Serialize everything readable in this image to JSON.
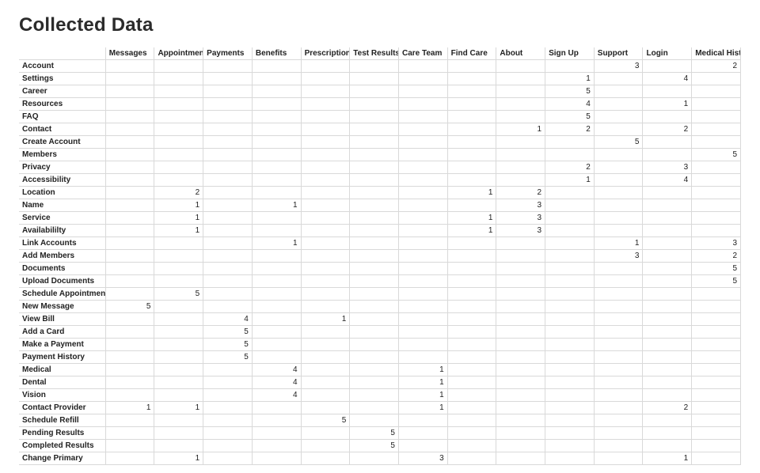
{
  "title": "Collected Data",
  "chart_data": {
    "type": "table",
    "title": "Collected Data",
    "columns": [
      "Messages",
      "Appointments",
      "Payments",
      "Benefits",
      "Prescriptions",
      "Test Results",
      "Care Team",
      "Find Care",
      "About",
      "Sign Up",
      "Support",
      "Login",
      "Medical History"
    ],
    "rows": [
      "Account",
      "Settings",
      "Career",
      "Resources",
      "FAQ",
      "Contact",
      "Create Account",
      "Members",
      "Privacy",
      "Accessibility",
      "Location",
      "Name",
      "Service",
      "Availabililty",
      "Link Accounts",
      "Add Members",
      "Documents",
      "Upload Documents",
      "Schedule Appointment",
      "New Message",
      "View Bill",
      "Add a Card",
      "Make a Payment",
      "Payment History",
      "Medical",
      "Dental",
      "Vision",
      "Contact Provider",
      "Schedule Refill",
      "Pending Results",
      "Completed Results",
      "Change Primary"
    ],
    "values": [
      [
        null,
        null,
        null,
        null,
        null,
        null,
        null,
        null,
        null,
        null,
        3,
        null,
        null,
        2
      ],
      [
        null,
        null,
        null,
        null,
        null,
        null,
        null,
        null,
        null,
        1,
        null,
        4,
        null,
        null
      ],
      [
        null,
        null,
        null,
        null,
        null,
        null,
        null,
        null,
        null,
        5,
        null,
        null,
        null,
        null
      ],
      [
        null,
        null,
        null,
        null,
        null,
        null,
        null,
        null,
        null,
        4,
        null,
        1,
        null,
        null
      ],
      [
        null,
        null,
        null,
        null,
        null,
        null,
        null,
        null,
        null,
        5,
        null,
        null,
        null,
        null
      ],
      [
        null,
        null,
        null,
        null,
        null,
        null,
        null,
        null,
        1,
        2,
        null,
        2,
        null,
        null
      ],
      [
        null,
        null,
        null,
        null,
        null,
        null,
        null,
        null,
        null,
        null,
        5,
        null,
        null,
        null
      ],
      [
        null,
        null,
        null,
        null,
        null,
        null,
        null,
        null,
        null,
        null,
        null,
        null,
        5,
        null
      ],
      [
        null,
        null,
        null,
        null,
        null,
        null,
        null,
        null,
        null,
        2,
        null,
        3,
        null,
        null
      ],
      [
        null,
        null,
        null,
        null,
        null,
        null,
        null,
        null,
        null,
        1,
        null,
        4,
        null,
        null
      ],
      [
        null,
        2,
        null,
        null,
        null,
        null,
        null,
        1,
        2,
        null,
        null,
        null,
        null,
        null
      ],
      [
        null,
        1,
        null,
        1,
        null,
        null,
        null,
        null,
        3,
        null,
        null,
        null,
        null,
        null
      ],
      [
        null,
        1,
        null,
        null,
        null,
        null,
        null,
        1,
        3,
        null,
        null,
        null,
        null,
        null
      ],
      [
        null,
        1,
        null,
        null,
        null,
        null,
        null,
        1,
        3,
        null,
        null,
        null,
        null,
        null
      ],
      [
        null,
        null,
        null,
        1,
        null,
        null,
        null,
        null,
        null,
        null,
        1,
        null,
        3,
        null
      ],
      [
        null,
        null,
        null,
        null,
        null,
        null,
        null,
        null,
        null,
        null,
        3,
        null,
        2,
        null
      ],
      [
        null,
        null,
        null,
        null,
        null,
        null,
        null,
        null,
        null,
        null,
        null,
        null,
        null,
        5
      ],
      [
        null,
        null,
        null,
        null,
        null,
        null,
        null,
        null,
        null,
        null,
        null,
        null,
        null,
        5
      ],
      [
        null,
        5,
        null,
        null,
        null,
        null,
        null,
        null,
        null,
        null,
        null,
        null,
        null,
        null
      ],
      [
        5,
        null,
        null,
        null,
        null,
        null,
        null,
        null,
        null,
        null,
        null,
        null,
        null,
        null
      ],
      [
        null,
        null,
        4,
        null,
        1,
        null,
        null,
        null,
        null,
        null,
        null,
        null,
        null,
        null
      ],
      [
        null,
        null,
        5,
        null,
        null,
        null,
        null,
        null,
        null,
        null,
        null,
        null,
        null,
        null
      ],
      [
        null,
        null,
        5,
        null,
        null,
        null,
        null,
        null,
        null,
        null,
        null,
        null,
        null,
        null
      ],
      [
        null,
        null,
        5,
        null,
        null,
        null,
        null,
        null,
        null,
        null,
        null,
        null,
        null,
        null
      ],
      [
        null,
        null,
        null,
        4,
        null,
        null,
        1,
        null,
        null,
        null,
        null,
        null,
        null,
        null
      ],
      [
        null,
        null,
        null,
        4,
        null,
        null,
        1,
        null,
        null,
        null,
        null,
        null,
        null,
        null
      ],
      [
        null,
        null,
        null,
        4,
        null,
        null,
        1,
        null,
        null,
        null,
        null,
        null,
        null,
        null
      ],
      [
        1,
        1,
        null,
        null,
        null,
        null,
        1,
        null,
        null,
        null,
        null,
        2,
        null,
        null
      ],
      [
        null,
        null,
        null,
        null,
        5,
        null,
        null,
        null,
        null,
        null,
        null,
        null,
        null,
        null
      ],
      [
        null,
        null,
        null,
        null,
        null,
        5,
        null,
        null,
        null,
        null,
        null,
        null,
        null,
        null
      ],
      [
        null,
        null,
        null,
        null,
        null,
        5,
        null,
        null,
        null,
        null,
        null,
        null,
        null,
        null
      ],
      [
        null,
        1,
        null,
        null,
        null,
        null,
        3,
        null,
        null,
        null,
        null,
        1,
        null,
        null
      ]
    ]
  }
}
